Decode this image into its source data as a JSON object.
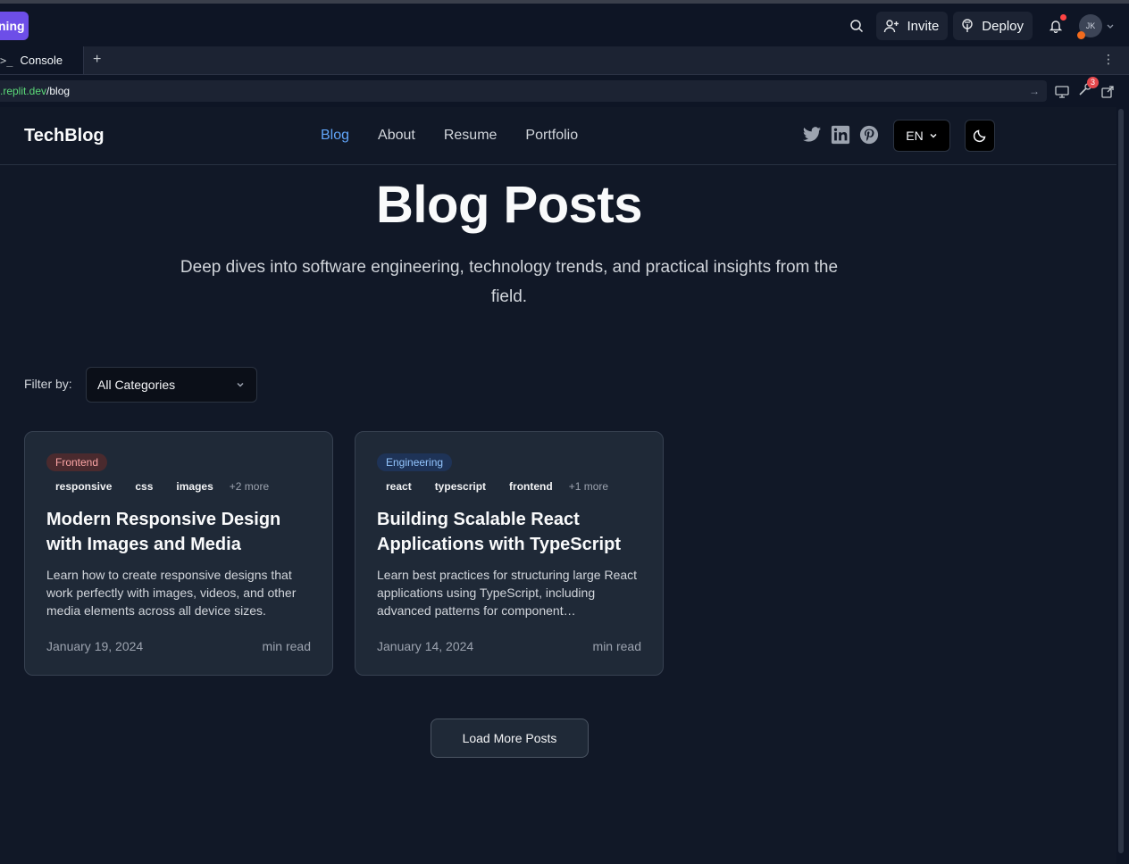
{
  "ide": {
    "run_label": "ning",
    "invite_label": "Invite",
    "deploy_label": "Deploy",
    "avatar_initials": "JK",
    "tab_console": "Console",
    "tab_console_prompt": ">_",
    "tab_add": "+",
    "url_host": ".replit.dev",
    "url_path": "/blog",
    "devtools_badge": "3"
  },
  "site": {
    "brand": "TechBlog",
    "nav": [
      {
        "label": "Blog",
        "active": true
      },
      {
        "label": "About"
      },
      {
        "label": "Resume"
      },
      {
        "label": "Portfolio"
      }
    ],
    "lang": "EN",
    "hero_title": "Blog Posts",
    "hero_subtitle": "Deep dives into software engineering, technology trends, and practical insights from the field.",
    "filter_label": "Filter by:",
    "filter_value": "All Categories",
    "posts": [
      {
        "category": "Frontend",
        "tags": [
          "responsive",
          "css",
          "images"
        ],
        "more": "+2 more",
        "title": "Modern Responsive Design with Images and Media",
        "excerpt": "Learn how to create responsive designs that work perfectly with images, videos, and other media elements across all device sizes.",
        "date": "January 19, 2024",
        "read": "min read"
      },
      {
        "category": "Engineering",
        "tags": [
          "react",
          "typescript",
          "frontend"
        ],
        "more": "+1 more",
        "title": "Building Scalable React Applications with TypeScript",
        "excerpt": "Learn best practices for structuring large React applications using TypeScript, including advanced patterns for component…",
        "date": "January 14, 2024",
        "read": "min read"
      }
    ],
    "load_more": "Load More Posts"
  }
}
